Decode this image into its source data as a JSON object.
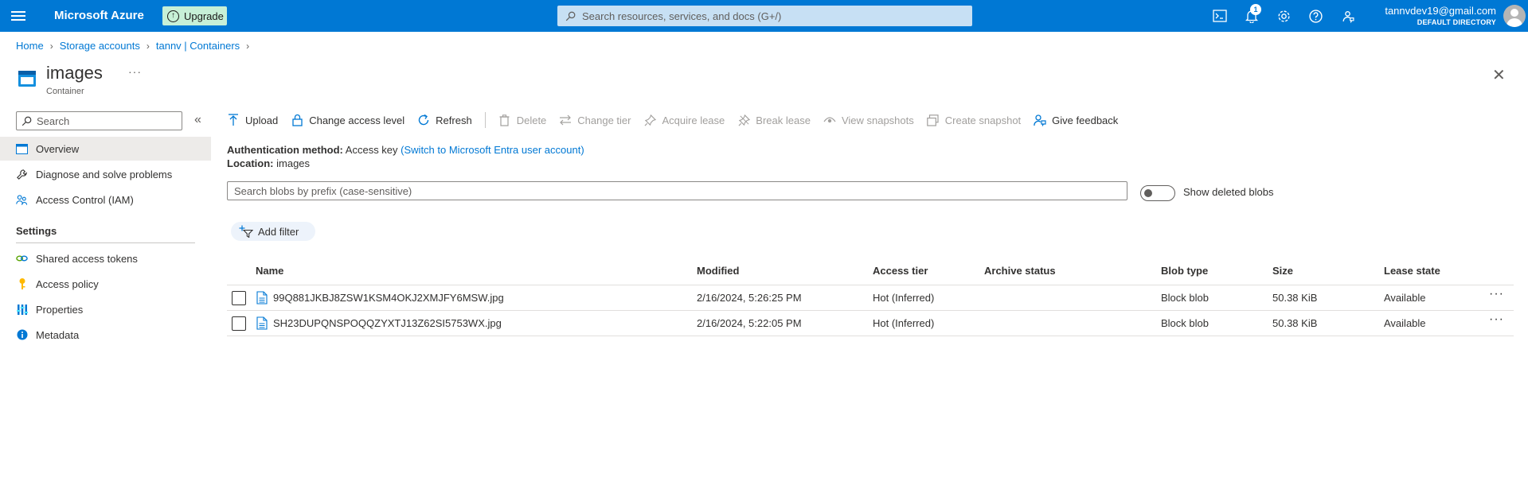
{
  "topbar": {
    "brand": "Microsoft Azure",
    "upgrade_label": "Upgrade",
    "search_placeholder": "Search resources, services, and docs (G+/)",
    "notification_count": "1",
    "account_email": "tannvdev19@gmail.com",
    "account_directory": "DEFAULT DIRECTORY",
    "icons": [
      "menu-icon",
      "cloud-shell-icon",
      "bell-icon",
      "gear-icon",
      "help-icon",
      "feedback-icon"
    ]
  },
  "breadcrumb": [
    "Home",
    "Storage accounts",
    "tannv | Containers"
  ],
  "page": {
    "title": "images",
    "subtitle": "Container",
    "more": "···",
    "close": "✕"
  },
  "sidebar": {
    "search_placeholder": "Search",
    "collapse": "«",
    "items": [
      {
        "label": "Overview",
        "icon": "overview-icon",
        "active": true
      },
      {
        "label": "Diagnose and solve problems",
        "icon": "wrench-icon"
      },
      {
        "label": "Access Control (IAM)",
        "icon": "people-icon"
      }
    ],
    "section_title": "Settings",
    "settings_items": [
      {
        "label": "Shared access tokens",
        "icon": "link-icon"
      },
      {
        "label": "Access policy",
        "icon": "key-icon"
      },
      {
        "label": "Properties",
        "icon": "properties-icon"
      },
      {
        "label": "Metadata",
        "icon": "info-icon"
      }
    ]
  },
  "toolbar": {
    "upload": "Upload",
    "change_access": "Change access level",
    "refresh": "Refresh",
    "delete": "Delete",
    "change_tier": "Change tier",
    "acquire_lease": "Acquire lease",
    "break_lease": "Break lease",
    "view_snapshots": "View snapshots",
    "create_snapshot": "Create snapshot",
    "give_feedback": "Give feedback"
  },
  "info": {
    "auth_label": "Authentication method:",
    "auth_value": "Access key",
    "auth_link": "(Switch to Microsoft Entra user account)",
    "location_label": "Location:",
    "location_value": "images"
  },
  "blob_search_placeholder": "Search blobs by prefix (case-sensitive)",
  "show_deleted_label": "Show deleted blobs",
  "show_deleted_on": false,
  "add_filter_label": "Add filter",
  "table": {
    "columns": [
      "Name",
      "Modified",
      "Access tier",
      "Archive status",
      "Blob type",
      "Size",
      "Lease state"
    ],
    "rows": [
      {
        "name": "99Q881JKBJ8ZSW1KSM4OKJ2XMJFY6MSW.jpg",
        "modified": "2/16/2024, 5:26:25 PM",
        "tier": "Hot (Inferred)",
        "archive": "",
        "type": "Block blob",
        "size": "50.38 KiB",
        "lease": "Available"
      },
      {
        "name": "SH23DUPQNSPOQQZYXTJ13Z62SI5753WX.jpg",
        "modified": "2/16/2024, 5:22:05 PM",
        "tier": "Hot (Inferred)",
        "archive": "",
        "type": "Block blob",
        "size": "50.38 KiB",
        "lease": "Available"
      }
    ]
  },
  "colors": {
    "accent": "#0078d4",
    "topbar": "#0078d4",
    "upgrade_bg": "#c7f0d7"
  }
}
